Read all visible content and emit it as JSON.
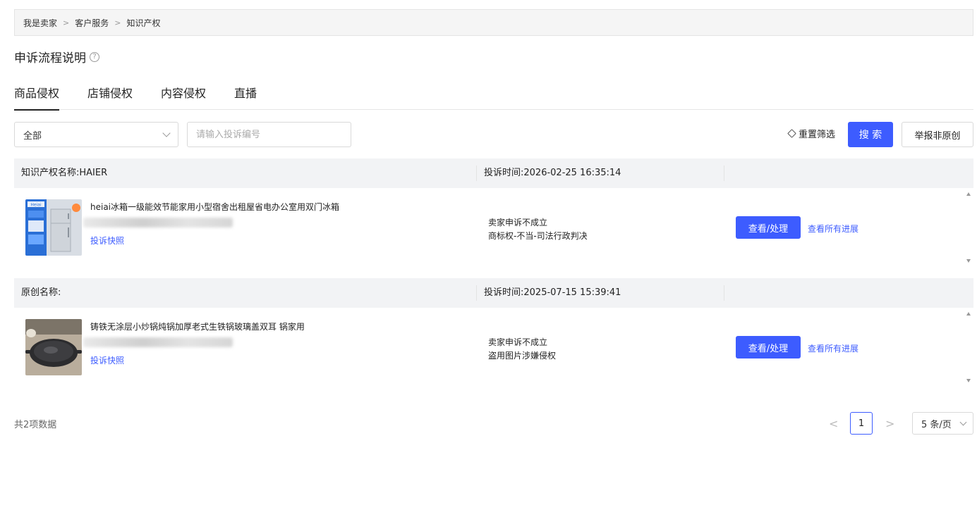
{
  "breadcrumb": {
    "items": [
      "我是卖家",
      "客户服务",
      "知识产权"
    ],
    "separator": ">"
  },
  "page_title": "申诉流程说明",
  "help_icon": "?",
  "tabs": [
    {
      "label": "商品侵权",
      "active": true
    },
    {
      "label": "店铺侵权",
      "active": false
    },
    {
      "label": "内容侵权",
      "active": false
    },
    {
      "label": "直播",
      "active": false
    }
  ],
  "filters": {
    "select_value": "全部",
    "search_placeholder": "请输入投诉编号",
    "reset_label": "重置筛选",
    "search_label": "搜 索",
    "report_label": "举报非原创"
  },
  "records": [
    {
      "name_label": "知识产权名称:HAIER",
      "time_label": "投诉时间:2026-02-25 16:35:14",
      "product_title": "heiai冰箱一级能效节能家用小型宿舍出租屋省电办公室用双门冰箱",
      "snapshot_label": "投诉快照",
      "status_line1": "卖家申诉不成立",
      "status_line2": "商标权-不当-司法行政判决",
      "view_label": "查看/处理",
      "progress_label": "查看所有进展",
      "thumb_icon": "fridge-image",
      "thumb_brand": "Heiai"
    },
    {
      "name_label": "原创名称:",
      "time_label": "投诉时间:2025-07-15 15:39:41",
      "product_title": "铸铁无涂层小炒锅炖锅加厚老式生铁锅玻璃盖双耳 锅家用",
      "snapshot_label": "投诉快照",
      "status_line1": "卖家申诉不成立",
      "status_line2": "盗用图片涉嫌侵权",
      "view_label": "查看/处理",
      "progress_label": "查看所有进展",
      "thumb_icon": "wok-image"
    }
  ],
  "pagination": {
    "total_label": "共2项数据",
    "current_page": "1",
    "prev_icon": "<",
    "next_icon": ">",
    "page_size_label": "5 条/页"
  },
  "colors": {
    "primary": "#3d5cff",
    "header_bg": "#f2f3f5"
  }
}
